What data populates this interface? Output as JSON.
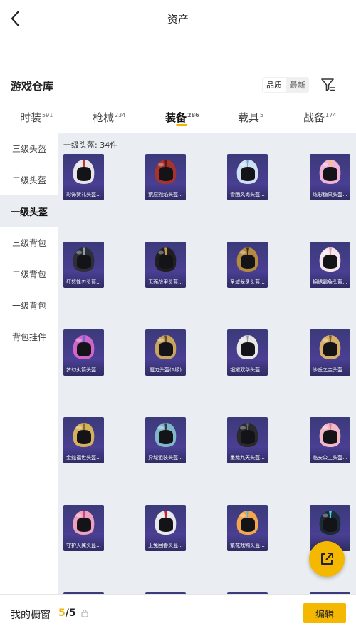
{
  "header": {
    "title": "资产"
  },
  "warehouse": {
    "title": "游戏仓库",
    "sort_options": [
      "品质",
      "最新"
    ]
  },
  "tabs": [
    {
      "label": "时装",
      "count": "591"
    },
    {
      "label": "枪械",
      "count": "234"
    },
    {
      "label": "装备",
      "count": "286"
    },
    {
      "label": "载具",
      "count": "5"
    },
    {
      "label": "战备",
      "count": "174"
    }
  ],
  "sidebar": {
    "items": [
      "三级头盔",
      "二级头盔",
      "一级头盔",
      "三级背包",
      "二级背包",
      "一级背包",
      "背包挂件"
    ]
  },
  "content": {
    "count_label": "一级头盔: 34件",
    "items": [
      {
        "name": "彩饰贺礼头盔...",
        "color": "#e9e4ea",
        "accent": "#c0392b"
      },
      {
        "name": "荒原烈焰头盔...",
        "color": "#a8322c",
        "accent": "#5a1a18"
      },
      {
        "name": "雪团风尚头盔...",
        "color": "#cfe0f2",
        "accent": "#7aa6d6"
      },
      {
        "name": "炫彩糖果头盔...",
        "color": "#f1b3d6",
        "accent": "#f7c85a"
      },
      {
        "name": "狂怒锋刃头盔...",
        "color": "#2c2f36",
        "accent": "#8fa0b5"
      },
      {
        "name": "无面战甲头盔...",
        "color": "#1f1f22",
        "accent": "#c79a4a"
      },
      {
        "name": "圣域龙灵头盔...",
        "color": "#b38a3e",
        "accent": "#3a2a12"
      },
      {
        "name": "锦绣霜兔头盔...",
        "color": "#f4e6ea",
        "accent": "#e39ab1"
      },
      {
        "name": "梦幻火箭头盔...",
        "color": "#d064c8",
        "accent": "#5f6bd8"
      },
      {
        "name": "魔刀头盔(1级)",
        "color": "#c9a45c",
        "accent": "#6b5020"
      },
      {
        "name": "银耀双华头盔...",
        "color": "#e6e6e6",
        "accent": "#9a9a9a"
      },
      {
        "name": "沙丘之主头盔...",
        "color": "#d8b06a",
        "accent": "#7b5a2a"
      },
      {
        "name": "金蛇福世头盔...",
        "color": "#d6b15c",
        "accent": "#8a6a2c"
      },
      {
        "name": "异域狙装头盔...",
        "color": "#7fb6c9",
        "accent": "#2d3e48"
      },
      {
        "name": "墨龙九天头盔...",
        "color": "#2a2a2e",
        "accent": "#6a6a72"
      },
      {
        "name": "临安公主头盔...",
        "color": "#f3b9c7",
        "accent": "#e27a96"
      },
      {
        "name": "守护天翼头盔...",
        "color": "#ef9fbf",
        "accent": "#c24a7e"
      },
      {
        "name": "玉兔回春头盔...",
        "color": "#e8e8ec",
        "accent": "#c8262e"
      },
      {
        "name": "繁花戏鸭头盔...",
        "color": "#f2a84a",
        "accent": "#5eaee0"
      },
      {
        "name": "炫...",
        "color": "#1d2a38",
        "accent": "#44d0e0"
      },
      {
        "name": "",
        "color": "#2f2c62",
        "accent": "#2f2c62"
      },
      {
        "name": "",
        "color": "#2f2c62",
        "accent": "#2f2c62"
      },
      {
        "name": "",
        "color": "#2f2c62",
        "accent": "#2f2c62"
      },
      {
        "name": "",
        "color": "#2f2c62",
        "accent": "#2f2c62"
      }
    ]
  },
  "bottom": {
    "label": "我的橱窗",
    "current": "5",
    "total": "/5",
    "edit_label": "编辑"
  },
  "colors": {
    "accent": "#f5b800",
    "panel": "#eaedf1",
    "card": "#4a3f93"
  },
  "icons": {
    "back": "chevron-left-icon",
    "filter": "filter-icon",
    "share": "external-link-icon",
    "lock": "lock-icon"
  }
}
